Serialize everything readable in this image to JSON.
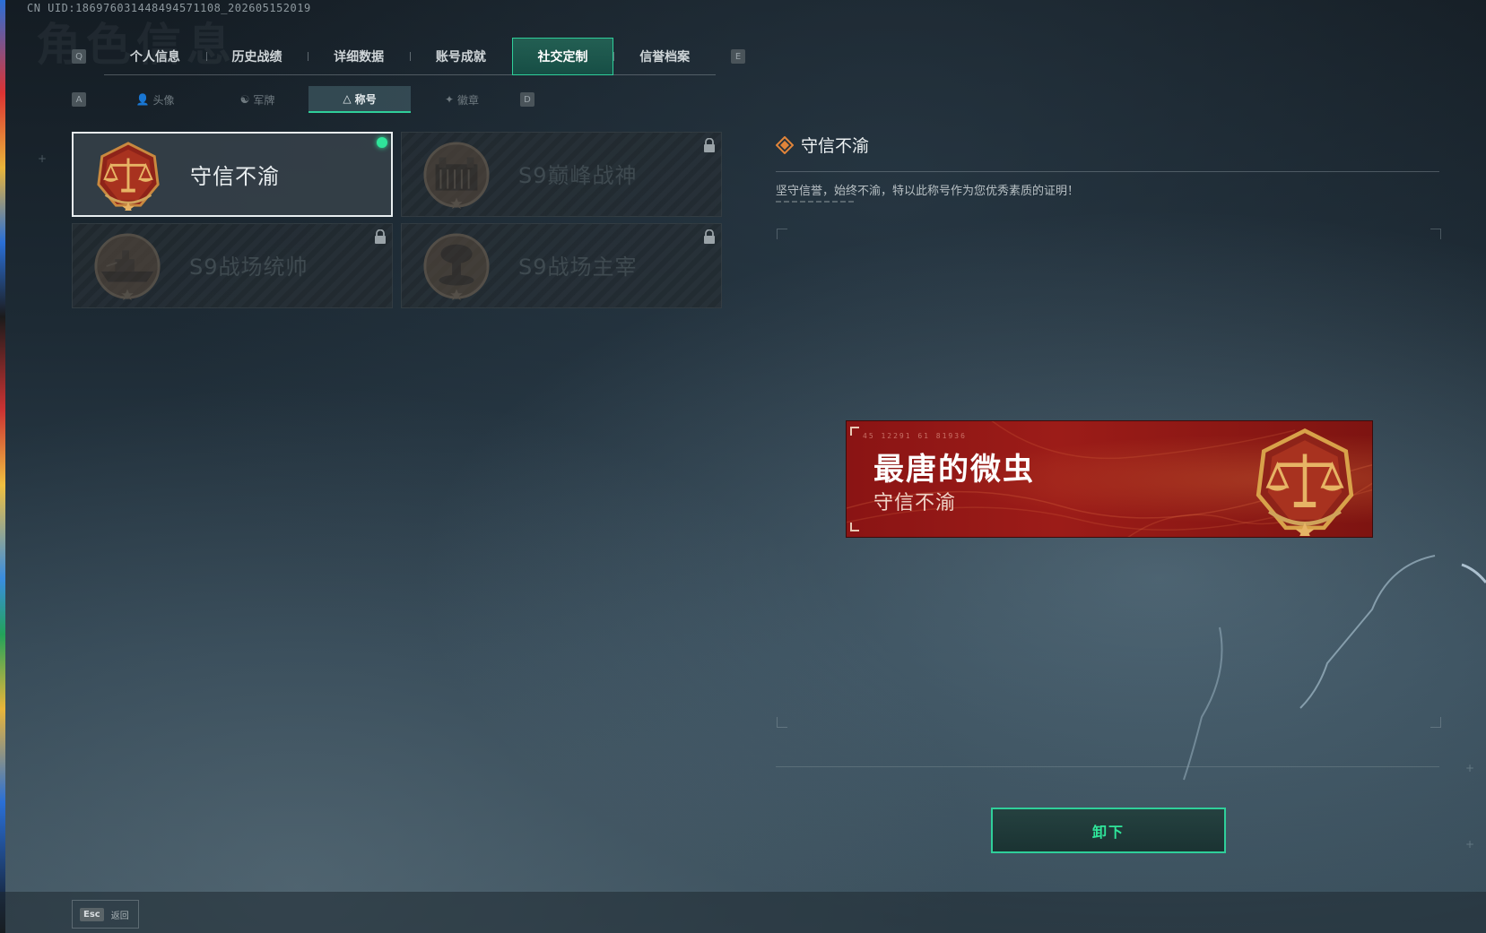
{
  "uid_text": "CN UID:1869760314484945711​08_202605152019",
  "page_bg_title": "角色信息",
  "tabs": {
    "key_left": "Q",
    "key_right": "E",
    "items": [
      {
        "label": "个人信息"
      },
      {
        "label": "历史战绩"
      },
      {
        "label": "详细数据"
      },
      {
        "label": "账号成就"
      },
      {
        "label": "社交定制",
        "active": true
      },
      {
        "label": "信誉档案"
      }
    ]
  },
  "subtabs": {
    "key_left": "A",
    "key_right": "D",
    "items": [
      {
        "label": "头像",
        "icon": "person-icon"
      },
      {
        "label": "军牌",
        "icon": "dogtag-icon"
      },
      {
        "label": "称号",
        "icon": "triangle-icon",
        "active": true
      },
      {
        "label": "徽章",
        "icon": "wings-icon"
      }
    ]
  },
  "titles": [
    {
      "label": "守信不渝",
      "icon": "scales-badge-icon",
      "selected": true,
      "equipped": true,
      "locked": false
    },
    {
      "label": "S9巅峰战神",
      "icon": "fortress-badge-icon",
      "selected": false,
      "locked": true
    },
    {
      "label": "S9战场统帅",
      "icon": "warship-badge-icon",
      "selected": false,
      "locked": true
    },
    {
      "label": "S9战场主宰",
      "icon": "mushroom-cloud-badge-icon",
      "selected": false,
      "locked": true
    }
  ],
  "detail": {
    "title": "守信不渝",
    "description": "坚守信誉，始终不渝，特以此称号作为您优秀素质的证明！",
    "nameplate": {
      "player_name": "最唐的微虫",
      "title": "守信不渝",
      "code_text": "45 12291  61 81936"
    },
    "action_label": "卸下"
  },
  "footer": {
    "esc_key": "Esc",
    "back_label": "返回"
  },
  "colors": {
    "accent": "#2fcf9a",
    "nameplate_red": "#9c1c18",
    "badge_gold": "#d8a24a"
  }
}
